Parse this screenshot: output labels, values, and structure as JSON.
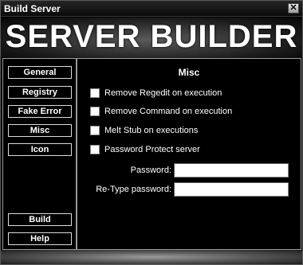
{
  "window": {
    "title": "Build Server",
    "close_glyph": "✕"
  },
  "banner": {
    "text": "SERVER BUILDER"
  },
  "sidebar": {
    "items": [
      {
        "label": "General"
      },
      {
        "label": "Registry"
      },
      {
        "label": "Fake Error"
      },
      {
        "label": "Misc"
      },
      {
        "label": "Icon"
      }
    ],
    "actions": [
      {
        "label": "Build"
      },
      {
        "label": "Help"
      }
    ]
  },
  "content": {
    "heading": "Misc",
    "options": [
      {
        "label": "Remove Regedit on execution",
        "checked": false
      },
      {
        "label": "Remove Command on execution",
        "checked": false
      },
      {
        "label": "Melt Stub on executions",
        "checked": false
      },
      {
        "label": "Password Protect server",
        "checked": false
      }
    ],
    "password_label": "Password:",
    "password_value": "",
    "retype_label": "Re-Type password:",
    "retype_value": ""
  }
}
